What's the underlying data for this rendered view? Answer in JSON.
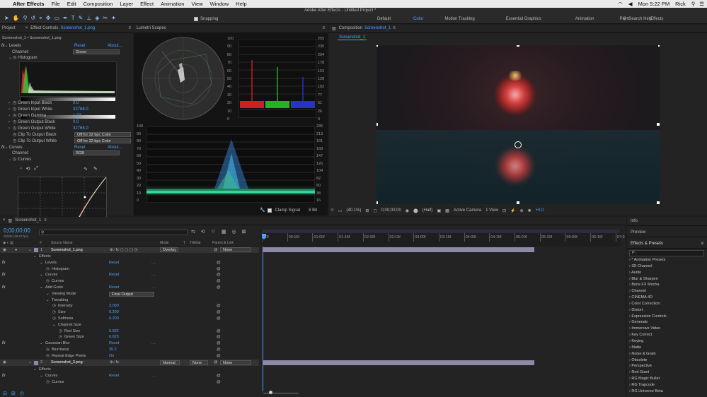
{
  "menubar": {
    "app": "After Effects",
    "items": [
      "File",
      "Edit",
      "Composition",
      "Layer",
      "Effect",
      "Animation",
      "View",
      "Window",
      "Help"
    ],
    "clock": "Mon 5:22 PM",
    "user": "Rick"
  },
  "toolbar": {
    "title": "Adobe After Effects - Untitled Project *",
    "snapping": "Snapping",
    "workspaces": [
      "Default",
      "Color",
      "Motion Tracking",
      "Essential Graphics",
      "Animation",
      "Paint",
      "Effects"
    ],
    "active_workspace": "Color",
    "search": "Search Help"
  },
  "project_panel": {
    "tab1": "Project",
    "tab2": "Effect Controls",
    "tab2_file": "Screenshot_1.png",
    "breadcrumb": "Screenshot_1 • Screenshot_1.png"
  },
  "levels": {
    "name": "Levels",
    "reset": "Reset",
    "about": "About...",
    "channel_label": "Channel:",
    "channel_value": "Green",
    "histogram": "Histogram",
    "props": [
      {
        "label": "Green Input Black",
        "value": "0.0"
      },
      {
        "label": "Green Input White",
        "value": "32768.0"
      },
      {
        "label": "Green Gamma",
        "value": "1.03"
      },
      {
        "label": "Green Output Black",
        "value": "0.0"
      },
      {
        "label": "Green Output White",
        "value": "32768.0"
      }
    ],
    "clip_black": "Clip To Output Black",
    "clip_white": "Clip To Output White",
    "clip_value": "Off for 32 bpc Color"
  },
  "curves": {
    "name": "Curves",
    "reset": "Reset",
    "about": "About...",
    "channel_label": "Channel:",
    "channel_value": "RGB",
    "sub": "Curves"
  },
  "scopes": {
    "tab": "Lumetri Scopes",
    "parade_left": [
      "100",
      "90",
      "80",
      "70",
      "60",
      "50",
      "40",
      "30",
      "20",
      "10",
      "0"
    ],
    "parade_right": [
      "255",
      "230",
      "204",
      "178",
      "153",
      "128",
      "102",
      "77",
      "51",
      "26",
      "0"
    ],
    "wave_left": [
      "100",
      "90",
      "80",
      "70",
      "60",
      "50",
      "40",
      "30",
      "20",
      "10",
      "0"
    ],
    "wave_right": [
      "235",
      "213",
      "191",
      "169",
      "147",
      "126",
      "104",
      "82",
      "60",
      "38",
      "16"
    ],
    "clamp": "Clamp Signal",
    "bits": "8 Bit"
  },
  "composition": {
    "tab": "Composition",
    "tab_name": "Screenshot_1",
    "subtab": "Screenshot_1",
    "zoom": "(40.1%)",
    "timecode": "0;00;00;00",
    "resolution": "(Half)",
    "camera": "Active Camera",
    "views": "1 View",
    "exposure": "+0.0"
  },
  "timeline": {
    "tab": "Screenshot_1",
    "timecode": "0;00;00;00",
    "fps": "00000 (29.97 fps)",
    "col_source": "Source Name",
    "col_mode": "Mode",
    "col_t": "T",
    "col_trkmat": "TrkMat",
    "col_parent": "Parent & Link",
    "ruler": [
      "00f",
      "00:15f",
      "01:00f",
      "01:15f",
      "02:00f",
      "02:15f",
      "03:00f",
      "03:15f",
      "04:00f",
      "04:15f",
      "05:00f",
      "05:15f",
      "06:00f",
      "06:15f",
      "07:0"
    ],
    "layer1": {
      "num": "1",
      "name": "Screenshot_1.png",
      "mode": "Overlay",
      "parent": "None"
    },
    "layer2": {
      "num": "2",
      "name": "Screenshot_3.png",
      "mode": "Normal",
      "trkmat": "None",
      "parent": "None"
    },
    "rows": [
      {
        "indent": 1,
        "text": "Effects"
      },
      {
        "indent": 2,
        "text": "Levels",
        "fx": true,
        "reset": "Reset",
        "dots": "...."
      },
      {
        "indent": 3,
        "text": "Histogram",
        "sw": true
      },
      {
        "indent": 2,
        "text": "Curves",
        "fx": true,
        "reset": "Reset",
        "dots": "...."
      },
      {
        "indent": 3,
        "text": "Curves",
        "sw": true
      },
      {
        "indent": 2,
        "text": "Add Grain",
        "fx": true,
        "reset": "Reset",
        "dots": "...."
      },
      {
        "indent": 3,
        "text": "Viewing Mode",
        "dropdown": "Final Output"
      },
      {
        "indent": 3,
        "text": "Tweaking"
      },
      {
        "indent": 4,
        "text": "Intensity",
        "sw": true,
        "value": "3.000"
      },
      {
        "indent": 4,
        "text": "Size",
        "sw": true,
        "value": "0.200"
      },
      {
        "indent": 4,
        "text": "Softness",
        "sw": true,
        "value": "0.200"
      },
      {
        "indent": 4,
        "text": "Channel Size"
      },
      {
        "indent": 5,
        "text": "Red Size",
        "sw": true,
        "value": "0.582"
      },
      {
        "indent": 5,
        "text": "Green Size",
        "sw": true,
        "value": "0.625"
      },
      {
        "indent": 2,
        "text": "Gaussian Blur",
        "fx": true,
        "reset": "Reset",
        "dots": "...."
      },
      {
        "indent": 3,
        "text": "Blurriness",
        "sw": true,
        "value": "35.2"
      },
      {
        "indent": 3,
        "text": "Repeat Edge Pixels",
        "sw": true,
        "value": "On"
      }
    ],
    "rows2": [
      {
        "indent": 1,
        "text": "Effects"
      },
      {
        "indent": 2,
        "text": "Curves",
        "fx": true,
        "reset": "Reset",
        "dots": "...."
      },
      {
        "indent": 3,
        "text": "Curves",
        "sw": true
      }
    ]
  },
  "right_panel": {
    "info": "Info",
    "preview": "Preview",
    "effects_presets": "Effects & Presets",
    "search_placeholder": "P-",
    "categories": [
      "* Animation Presets",
      "3D Channel",
      "Audio",
      "Blur & Sharpen",
      "Boris FX Mocha",
      "Channel",
      "CINEMA 4D",
      "Color Correction",
      "Distort",
      "Expression Controls",
      "Generate",
      "Immersive Video",
      "Key Correct",
      "Keying",
      "Matte",
      "Noise & Grain",
      "Obsolete",
      "Perspective",
      "Red Giant",
      "RG Magic Bullet",
      "RG Trapcode",
      "RG Universe Beta"
    ]
  }
}
